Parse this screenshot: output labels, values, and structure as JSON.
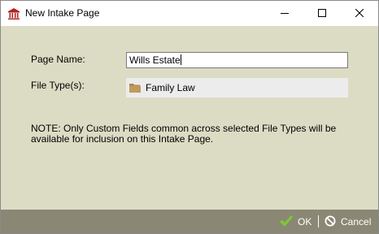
{
  "window": {
    "title": "New Intake Page",
    "app_icon": "law-firm-building-icon",
    "controls": {
      "minimize_icon": "minimize-icon",
      "maximize_icon": "maximize-icon",
      "close_icon": "close-icon"
    }
  },
  "form": {
    "page_name_label": "Page Name:",
    "page_name_value": "Wills Estate",
    "file_types_label": "File Type(s):",
    "file_types": [
      {
        "label": "Family Law",
        "icon": "folder-icon"
      }
    ],
    "note": "NOTE: Only Custom Fields common across selected File Types will be available for inclusion on this Intake Page."
  },
  "footer": {
    "ok_label": "OK",
    "ok_icon": "checkmark-icon",
    "cancel_label": "Cancel",
    "cancel_icon": "cancel-circle-icon"
  },
  "colors": {
    "dialog_background": "#dcdcc5",
    "footer_background": "#8a8774",
    "check_green": "#7ec832",
    "app_icon_red": "#b22222"
  }
}
